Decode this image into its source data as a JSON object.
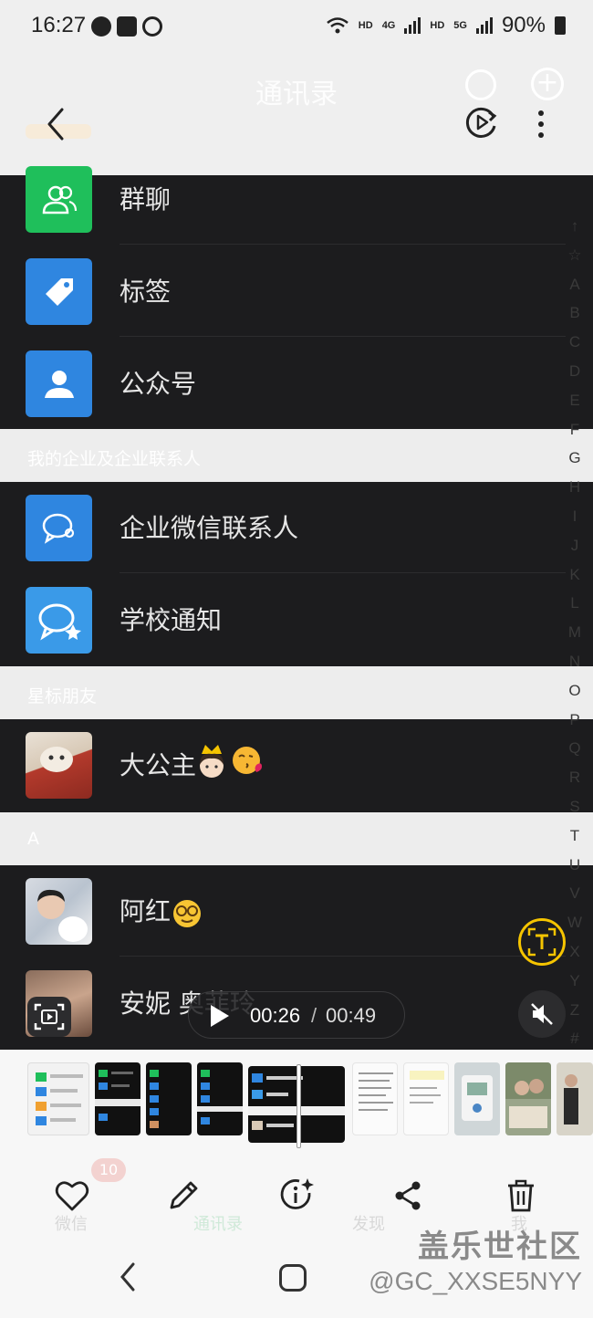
{
  "status_bar": {
    "time": "16:27",
    "net_hd_1": "HD",
    "net_4g": "4G",
    "net_hd_2": "HD",
    "net_5g": "5G",
    "battery": "90%"
  },
  "header": {
    "title": "通讯录"
  },
  "sections": {
    "top_rows": [
      {
        "label": "群聊",
        "icon": "group-chat-icon",
        "color": "#1fbf5b"
      },
      {
        "label": "标签",
        "icon": "tag-icon",
        "color": "#2f86e0"
      },
      {
        "label": "公众号",
        "icon": "official-account-icon",
        "color": "#2f86e0"
      }
    ],
    "enterprise_header": "我的企业及企业联系人",
    "enterprise_rows": [
      {
        "label": "企业微信联系人",
        "icon": "wecom-icon",
        "color": "#2f86e0"
      },
      {
        "label": "学校通知",
        "icon": "school-notice-icon",
        "color": "#3a9ae8"
      }
    ],
    "starred_header": "星标朋友",
    "starred_rows": [
      {
        "label": "大公主"
      }
    ],
    "a_header": "A",
    "a_rows": [
      {
        "label": "阿红"
      },
      {
        "label": "安妮 奥菲玲"
      }
    ]
  },
  "index_bar": [
    "↑",
    "☆",
    "A",
    "B",
    "C",
    "D",
    "E",
    "F",
    "G",
    "H",
    "I",
    "J",
    "K",
    "L",
    "M",
    "N",
    "O",
    "P",
    "Q",
    "R",
    "S",
    "T",
    "U",
    "V",
    "W",
    "X",
    "Y",
    "Z",
    "#"
  ],
  "video": {
    "current": "00:26",
    "separator": "/",
    "total": "00:49"
  },
  "ghost_tabs": {
    "chats": "微信",
    "chats_badge": "10",
    "contacts": "通讯录",
    "discover": "发现",
    "me": "我"
  },
  "watermark": {
    "brand": "盖乐世社区",
    "user": "@GC_XXSE5NYY"
  },
  "colors": {
    "list_bg": "#1c1c1e",
    "gap_bg": "#ededed",
    "accent_green": "#1fbf5b",
    "accent_blue": "#2f86e0",
    "ocr_yellow": "#f5c400"
  }
}
